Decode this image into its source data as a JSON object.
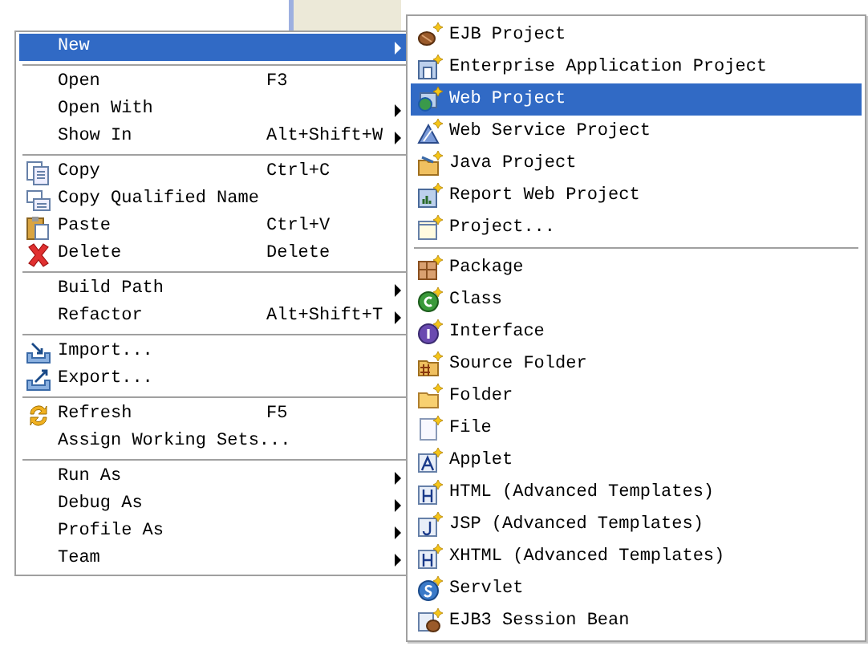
{
  "context_menu": {
    "groups": [
      [
        {
          "label": "New",
          "has_submenu": true,
          "selected": true
        }
      ],
      [
        {
          "label": "Open",
          "shortcut": "F3",
          "has_submenu": false,
          "selected": false
        },
        {
          "label": "Open With",
          "has_submenu": true,
          "selected": false
        },
        {
          "label": "Show In",
          "shortcut": "Alt+Shift+W",
          "has_submenu": true,
          "selected": false
        }
      ],
      [
        {
          "label": "Copy",
          "shortcut": "Ctrl+C",
          "has_submenu": false,
          "selected": false
        },
        {
          "label": "Copy Qualified Name",
          "has_submenu": false,
          "selected": false
        },
        {
          "label": "Paste",
          "shortcut": "Ctrl+V",
          "has_submenu": false,
          "selected": false
        },
        {
          "label": "Delete",
          "shortcut": "Delete",
          "has_submenu": false,
          "selected": false
        }
      ],
      [
        {
          "label": "Build Path",
          "has_submenu": true,
          "selected": false
        },
        {
          "label": "Refactor",
          "shortcut": "Alt+Shift+T",
          "has_submenu": true,
          "selected": false
        }
      ],
      [
        {
          "label": "Import...",
          "has_submenu": false,
          "selected": false
        },
        {
          "label": "Export...",
          "has_submenu": false,
          "selected": false
        }
      ],
      [
        {
          "label": "Refresh",
          "shortcut": "F5",
          "has_submenu": false,
          "selected": false
        },
        {
          "label": "Assign Working Sets...",
          "has_submenu": false,
          "selected": false
        }
      ],
      [
        {
          "label": "Run As",
          "has_submenu": true,
          "selected": false
        },
        {
          "label": "Debug As",
          "has_submenu": true,
          "selected": false
        },
        {
          "label": "Profile As",
          "has_submenu": true,
          "selected": false
        },
        {
          "label": "Team",
          "has_submenu": true,
          "selected": false
        }
      ]
    ]
  },
  "submenu": {
    "groups": [
      [
        {
          "label": "EJB Project",
          "selected": false
        },
        {
          "label": "Enterprise Application Project",
          "selected": false
        },
        {
          "label": "Web Project",
          "selected": true
        },
        {
          "label": "Web Service Project",
          "selected": false
        },
        {
          "label": "Java Project",
          "selected": false
        },
        {
          "label": "Report Web Project",
          "selected": false
        },
        {
          "label": "Project...",
          "selected": false
        }
      ],
      [
        {
          "label": "Package",
          "selected": false
        },
        {
          "label": "Class",
          "selected": false
        },
        {
          "label": "Interface",
          "selected": false
        },
        {
          "label": "Source Folder",
          "selected": false
        },
        {
          "label": "Folder",
          "selected": false
        },
        {
          "label": "File",
          "selected": false
        },
        {
          "label": "Applet",
          "selected": false
        },
        {
          "label": "HTML (Advanced Templates)",
          "selected": false
        },
        {
          "label": "JSP (Advanced Templates)",
          "selected": false
        },
        {
          "label": "XHTML (Advanced Templates)",
          "selected": false
        },
        {
          "label": "Servlet",
          "selected": false
        },
        {
          "label": "EJB3 Session Bean",
          "selected": false
        }
      ]
    ]
  }
}
